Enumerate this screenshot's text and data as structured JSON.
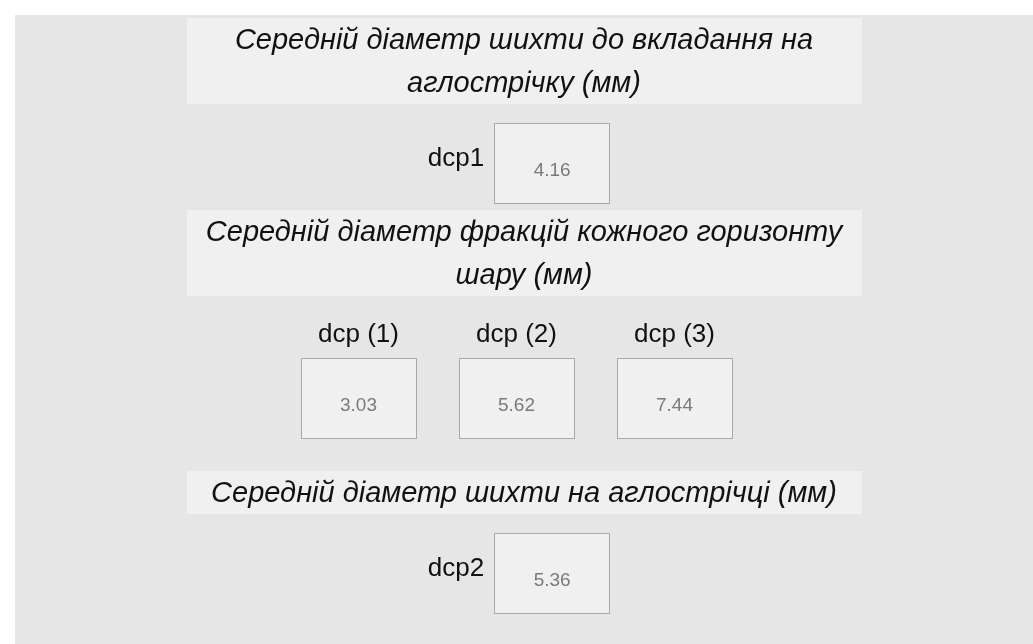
{
  "sections": [
    {
      "heading": "Середній діаметр шихти до вкладання на аглострічку (мм)",
      "kind": "inline",
      "fields": [
        {
          "label": "dcp1",
          "value": "4.16"
        }
      ]
    },
    {
      "heading": "Середній діаметр фракцій кожного горизонту шару (мм)",
      "kind": "stacked",
      "fields": [
        {
          "label": "dcp (1)",
          "value": "3.03"
        },
        {
          "label": "dcp (2)",
          "value": "5.62"
        },
        {
          "label": "dcp (3)",
          "value": "7.44"
        }
      ]
    },
    {
      "heading": "Середній діаметр шихти на аглострічці (мм)",
      "kind": "inline",
      "fields": [
        {
          "label": "dcp2",
          "value": "5.36"
        }
      ]
    }
  ]
}
